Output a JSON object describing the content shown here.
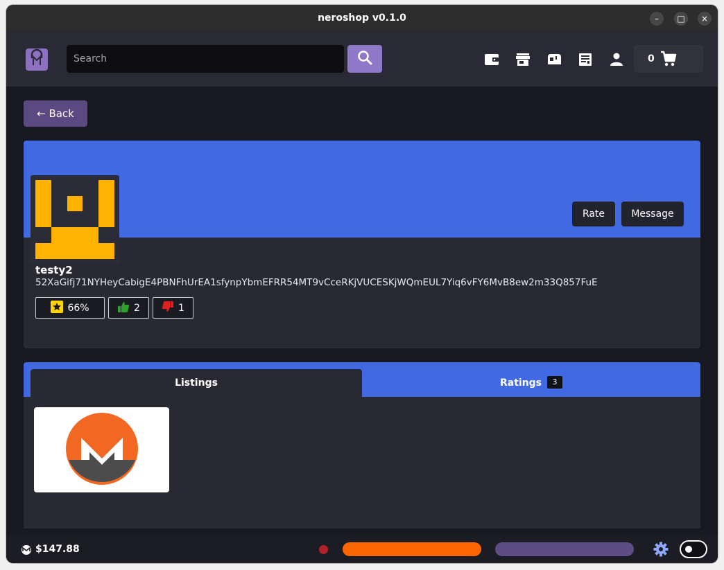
{
  "window": {
    "title": "neroshop v0.1.0",
    "minimize_label": "–",
    "maximize_label": "□",
    "close_label": "×"
  },
  "header": {
    "search_placeholder": "Search",
    "cart_count": "0",
    "nav_icons": [
      "wallet-icon",
      "store-icon",
      "inbox-icon",
      "orders-icon",
      "account-icon",
      "cart-icon"
    ]
  },
  "back_button": {
    "label": "← Back"
  },
  "profile": {
    "username": "testy2",
    "address": "52XaGifj71NYHeyCabigE4PBNFhUrEA1sfynpYbmEFRR54MT9vCceRKjVUCESKjWQmEUL7Yiq6vFY6MvB8ew2m33Q857FuE",
    "rate_label": "Rate",
    "message_label": "Message",
    "reputation": "66%",
    "likes": "2",
    "dislikes": "1",
    "banner_color": "#4169e1",
    "avatar_color": "#ffb300"
  },
  "tabs": {
    "listings_label": "Listings",
    "ratings_label": "Ratings",
    "ratings_count": "3"
  },
  "listings": [
    {
      "image": "monero-logo"
    }
  ],
  "status": {
    "balance": "$147.88",
    "sync_color": "#ff6600",
    "secondary_color": "#5e4d84",
    "status_dot_color": "#b0222a"
  }
}
